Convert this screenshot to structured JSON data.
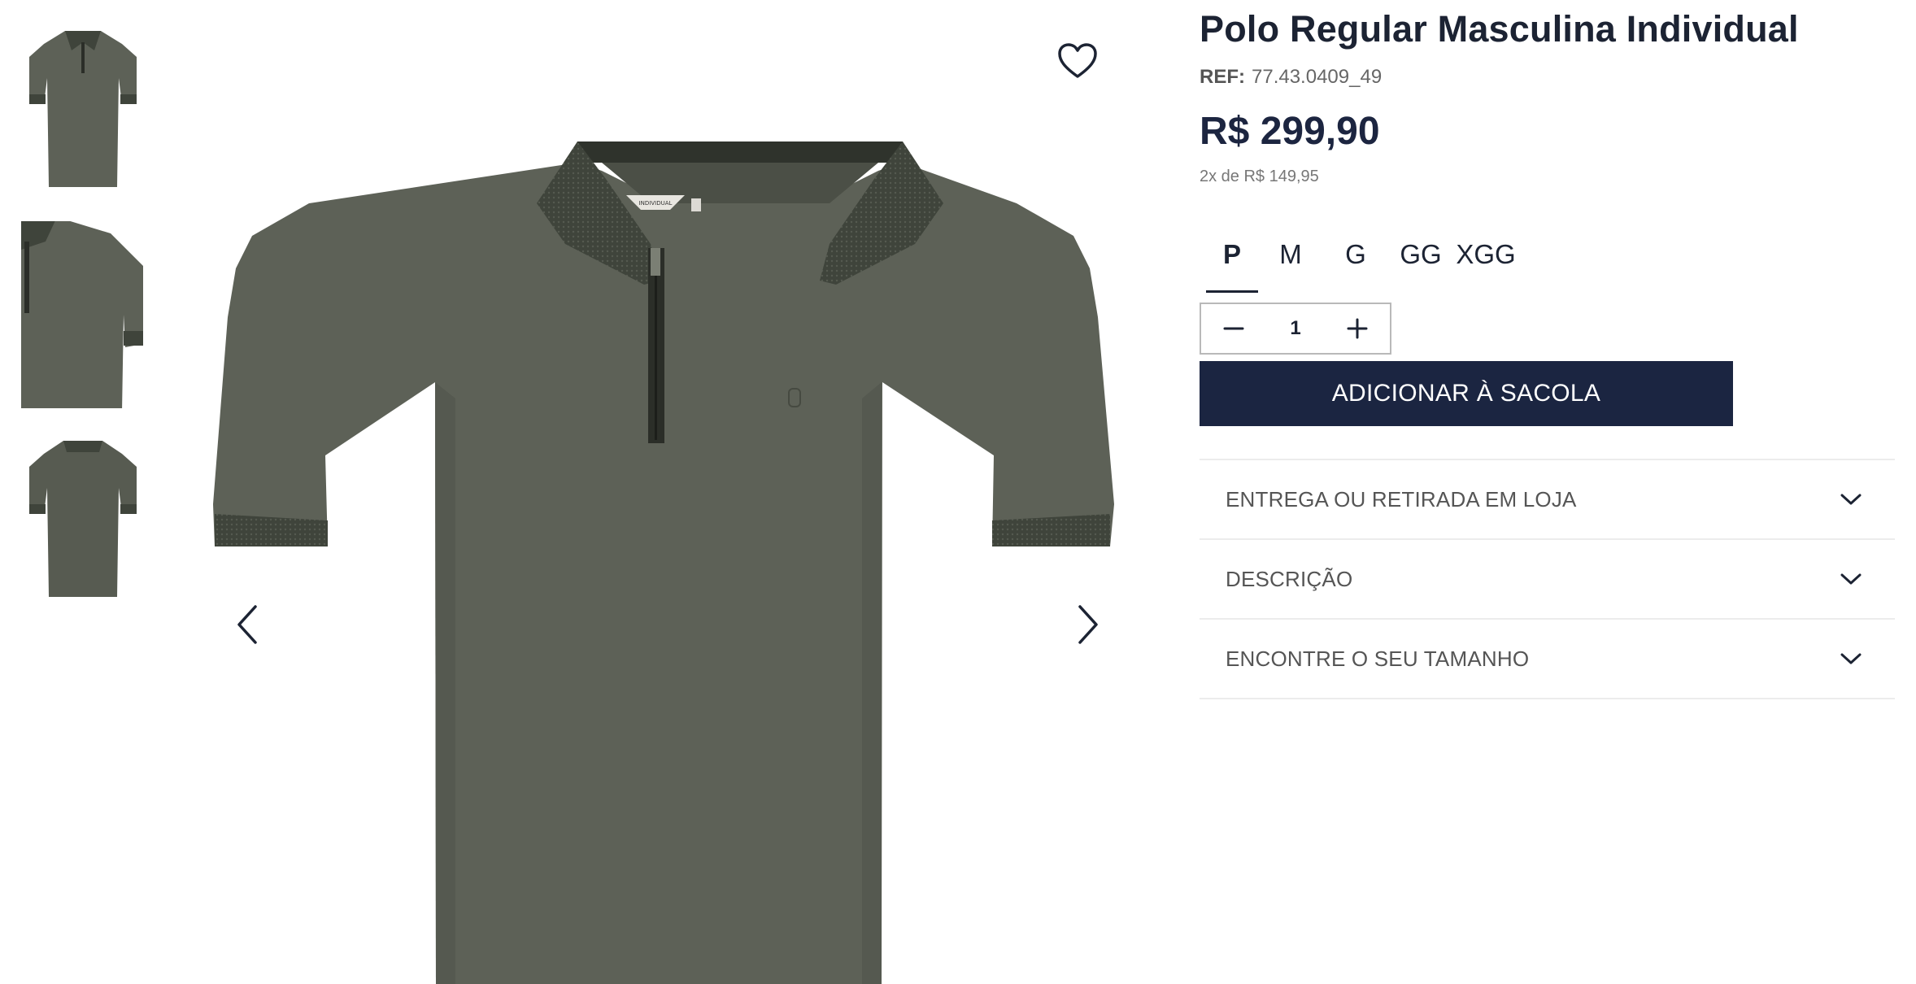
{
  "product": {
    "title": "Polo Regular Masculina Individual",
    "ref_label": "REF:",
    "ref_value": "77.43.0409_49",
    "price": "R$ 299,90",
    "installments": "2x de R$ 149,95"
  },
  "gallery": {
    "thumbnails": [
      "front-view",
      "side-view",
      "back-view"
    ],
    "favorite_icon": "heart-icon",
    "prev_icon": "chevron-left-icon",
    "next_icon": "chevron-right-icon",
    "collar_tag": "INDIVIDUAL"
  },
  "sizes": {
    "options": [
      "P",
      "M",
      "G",
      "GG",
      "XGG"
    ],
    "selected": "P"
  },
  "quantity": {
    "value": "1",
    "decrement_icon": "minus-icon",
    "increment_icon": "plus-icon"
  },
  "cart": {
    "add_label": "ADICIONAR À SACOLA"
  },
  "accordions": [
    {
      "label": "ENTREGA OU RETIRADA EM LOJA",
      "icon": "chevron-down-icon"
    },
    {
      "label": "DESCRIÇÃO",
      "icon": "chevron-down-icon"
    },
    {
      "label": "ENCONTRE O SEU TAMANHO",
      "icon": "chevron-down-icon"
    }
  ],
  "colors": {
    "primary": "#1b2541",
    "text": "#1c2333",
    "shirt": "#5d6157",
    "shirt_trim": "#3f443b"
  }
}
